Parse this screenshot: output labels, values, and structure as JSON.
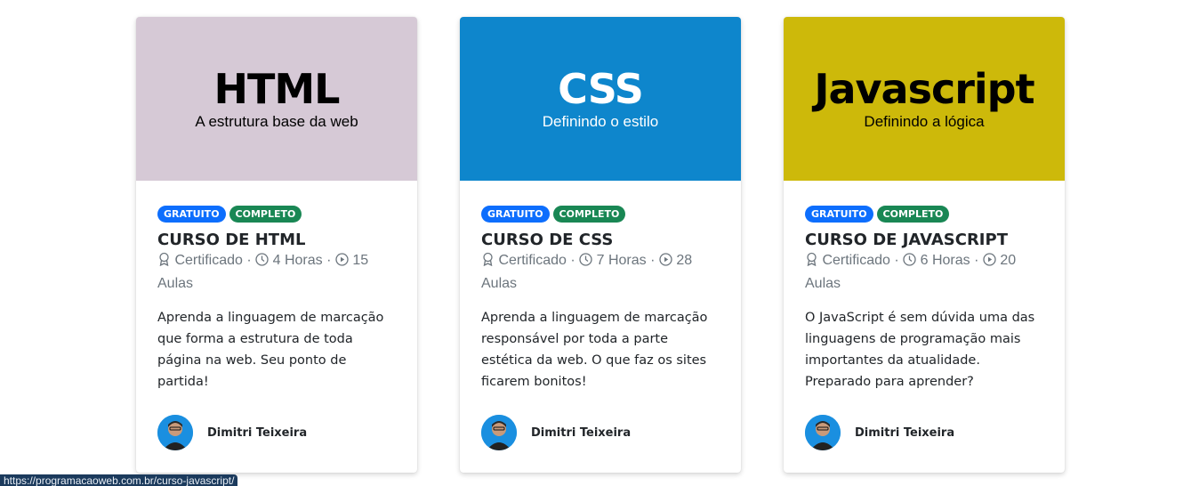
{
  "badges": {
    "free": "GRATUITO",
    "complete": "COMPLETO"
  },
  "colors": {
    "free_badge": "#0d6efd",
    "complete_badge": "#198754"
  },
  "courses": [
    {
      "banner_title": "HTML",
      "banner_subtitle": "A estrutura base da web",
      "banner_bg": "#d6c9d6",
      "banner_fg": "#000000",
      "title": "CURSO DE HTML",
      "certificate": "Certificado",
      "hours": "4 Horas",
      "lessons_count": "15",
      "lessons_label": "Aulas",
      "description": "Aprenda a linguagem de marcação que forma a estrutura de toda página na web. Seu ponto de partida!",
      "author": "Dimitri Teixeira"
    },
    {
      "banner_title": "CSS",
      "banner_subtitle": "Definindo o estilo",
      "banner_bg": "#0e86cc",
      "banner_fg": "#ffffff",
      "title": "CURSO DE CSS",
      "certificate": "Certificado",
      "hours": "7 Horas",
      "lessons_count": "28",
      "lessons_label": "Aulas",
      "description": "Aprenda a linguagem de marcação responsável por toda a parte estética da web. O que faz os sites ficarem bonitos!",
      "author": "Dimitri Teixeira"
    },
    {
      "banner_title": "Javascript",
      "banner_subtitle": "Definindo a lógica",
      "banner_bg": "#cdb90a",
      "banner_fg": "#000000",
      "title": "CURSO DE JAVASCRIPT",
      "certificate": "Certificado",
      "hours": "6 Horas",
      "lessons_count": "20",
      "lessons_label": "Aulas",
      "description": "O JavaScript é sem dúvida uma das linguagens de programação mais importantes da atualidade. Preparado para aprender?",
      "author": "Dimitri Teixeira"
    }
  ],
  "status_bar": {
    "url": "https://programacaoweb.com.br/curso-javascript/"
  }
}
